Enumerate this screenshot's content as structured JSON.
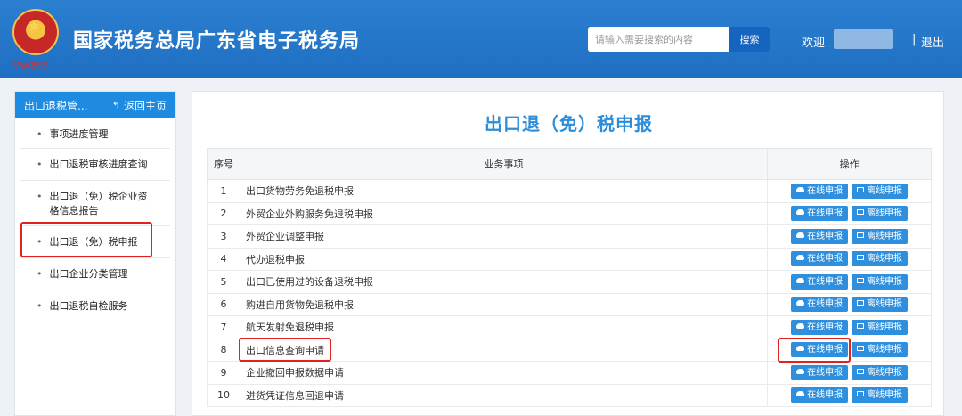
{
  "header": {
    "site_title": "国家税务总局广东省电子税务局",
    "emblem_signature": "中国税务",
    "search_placeholder": "请输入需要搜索的内容",
    "search_button": "搜索",
    "welcome": "欢迎",
    "divider": "|",
    "logout": "退出"
  },
  "sidebar": {
    "section_title": "出口退税管...",
    "back_label": "返回主页",
    "items": [
      {
        "label": "事项进度管理"
      },
      {
        "label": "出口退税审核进度查询"
      },
      {
        "label": "出口退（免）税企业资格信息报告"
      },
      {
        "label": "出口退（免）税申报"
      },
      {
        "label": "出口企业分类管理"
      },
      {
        "label": "出口退税自检服务"
      }
    ]
  },
  "main": {
    "title": "出口退（免）税申报",
    "columns": {
      "num": "序号",
      "item": "业务事项",
      "ops": "操作"
    },
    "online_label": "在线申报",
    "offline_label": "离线申报",
    "rows": [
      {
        "num": "1",
        "item": "出口货物劳务免退税申报"
      },
      {
        "num": "2",
        "item": "外贸企业外购服务免退税申报"
      },
      {
        "num": "3",
        "item": "外贸企业调整申报"
      },
      {
        "num": "4",
        "item": "代办退税申报"
      },
      {
        "num": "5",
        "item": "出口已使用过的设备退税申报"
      },
      {
        "num": "6",
        "item": "购进自用货物免退税申报"
      },
      {
        "num": "7",
        "item": "航天发射免退税申报"
      },
      {
        "num": "8",
        "item": "出口信息查询申请"
      },
      {
        "num": "9",
        "item": "企业撤回申报数据申请"
      },
      {
        "num": "10",
        "item": "进货凭证信息回退申请"
      }
    ]
  },
  "colors": {
    "header_blue": "#2b7fd0",
    "accent_blue": "#2d8fde",
    "highlight_red": "#e0231e"
  }
}
